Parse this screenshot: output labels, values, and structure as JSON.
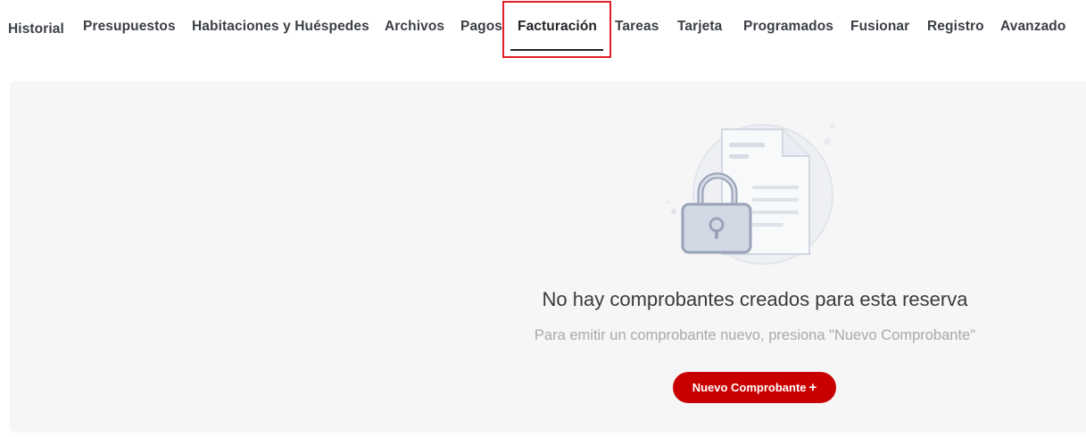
{
  "tabs": [
    {
      "label": "Historial"
    },
    {
      "label": "Presupuestos"
    },
    {
      "label": "Habitaciones y Huéspedes"
    },
    {
      "label": "Archivos"
    },
    {
      "label": "Pagos"
    },
    {
      "label": "Facturación"
    },
    {
      "label": "Tareas"
    },
    {
      "label": "Tarjeta"
    },
    {
      "label": "Programados"
    },
    {
      "label": "Fusionar"
    },
    {
      "label": "Registro"
    },
    {
      "label": "Avanzado"
    }
  ],
  "active_tab": "Facturación",
  "empty_state": {
    "title": "No hay comprobantes creados para esta reserva",
    "subtitle": "Para emitir un comprobante nuevo, presiona \"Nuevo Comprobante\"",
    "illustration_icon": "locked-document-icon"
  },
  "actions": {
    "new_button_label": "Nuevo Comprobante",
    "new_button_icon": "plus-icon"
  },
  "colors": {
    "accent": "#c80000",
    "highlight": "#e01f26"
  }
}
